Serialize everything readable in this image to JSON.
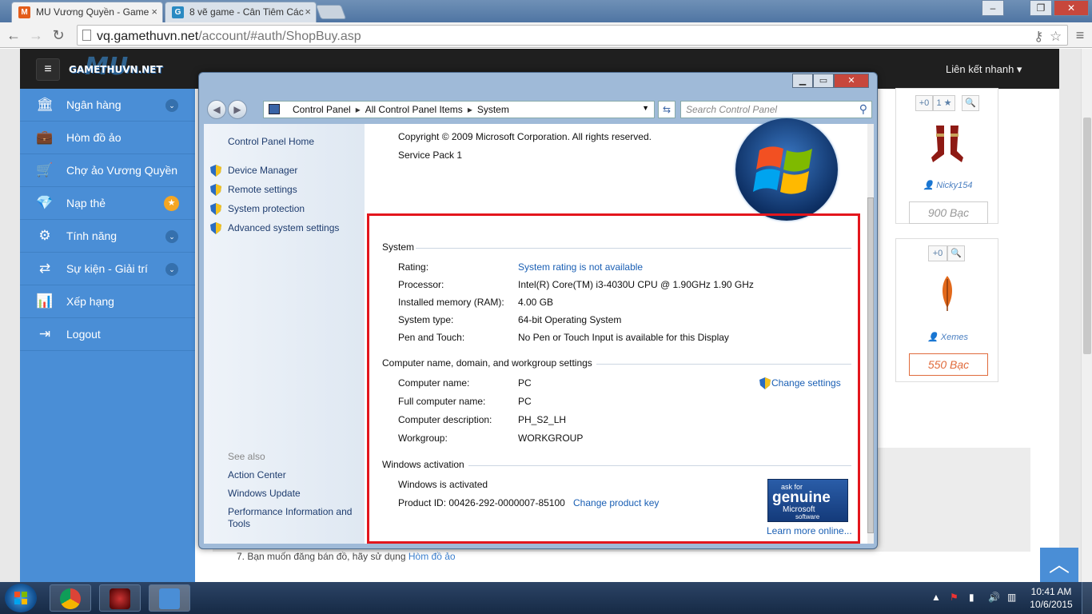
{
  "browser": {
    "tabs": [
      {
        "title": "MU Vương Quyền - Game",
        "close": "×"
      },
      {
        "title": "8 vẽ game - Cân Tiêm Các",
        "close": "×"
      }
    ],
    "url_host": "vq.gamethuvn.net",
    "url_path": "/account/#auth/ShopBuy.asp",
    "window_controls": [
      "–",
      "❐",
      "✕"
    ]
  },
  "site": {
    "logo_text": "GAMETHUVN.NET",
    "logo_mu": "MU",
    "quick_link": "Liên kết nhanh ▾",
    "sidebar": [
      {
        "icon": "bank-icon",
        "glyph": "🏛",
        "label": "Ngân hàng",
        "badge": "⌄"
      },
      {
        "icon": "briefcase-icon",
        "glyph": "💼",
        "label": "Hòm đồ ảo",
        "badge": ""
      },
      {
        "icon": "cart-icon",
        "glyph": "🛒",
        "label": "Chợ ảo Vương Quyền",
        "badge": ""
      },
      {
        "icon": "diamond-icon",
        "glyph": "💎",
        "label": "Nạp thẻ",
        "badge": "★"
      },
      {
        "icon": "gears-icon",
        "glyph": "⚙",
        "label": "Tính năng",
        "badge": "⌄"
      },
      {
        "icon": "share-icon",
        "glyph": "⇄",
        "label": "Sự kiện - Giải trí",
        "badge": "⌄"
      },
      {
        "icon": "chart-icon",
        "glyph": "📊",
        "label": "Xếp hạng",
        "badge": ""
      },
      {
        "icon": "logout-icon",
        "glyph": "⇥",
        "label": "Logout",
        "badge": ""
      }
    ],
    "cards": [
      {
        "btns": [
          "+0",
          "1 ★",
          "🔍"
        ],
        "seller": "Nicky154",
        "price": "900 Bạc"
      },
      {
        "btns": [
          "+0",
          "🔍"
        ],
        "seller": "Xemes",
        "price": "550 Bạc"
      }
    ],
    "note_prefix": "7. Bạn muốn đăng bán đồ, hãy sử dụng ",
    "note_link": "Hòm đồ ảo",
    "scroll_up": "︿"
  },
  "control_panel": {
    "breadcrumb": [
      "Control Panel",
      "All Control Panel Items",
      "System"
    ],
    "search_placeholder": "Search Control Panel",
    "left": {
      "home": "Control Panel Home",
      "links": [
        "Device Manager",
        "Remote settings",
        "System protection",
        "Advanced system settings"
      ],
      "see_also": "See also",
      "see_links": [
        "Action Center",
        "Windows Update",
        "Performance Information and",
        "Tools"
      ]
    },
    "copyright": "Copyright © 2009 Microsoft Corporation.  All rights reserved.",
    "service_pack": "Service Pack 1",
    "system": {
      "header": "System",
      "rows": [
        {
          "label": "Rating:",
          "value": "System rating is not available"
        },
        {
          "label": "Processor:",
          "value": "Intel(R) Core(TM) i3-4030U CPU @ 1.90GHz   1.90 GHz"
        },
        {
          "label": "Installed memory (RAM):",
          "value": "4.00 GB"
        },
        {
          "label": "System type:",
          "value": "64-bit Operating System"
        },
        {
          "label": "Pen and Touch:",
          "value": "No Pen or Touch Input is available for this Display"
        }
      ]
    },
    "computer": {
      "header": "Computer name, domain, and workgroup settings",
      "change_settings": "Change settings",
      "rows": [
        {
          "label": "Computer name:",
          "value": "PC"
        },
        {
          "label": "Full computer name:",
          "value": "PC"
        },
        {
          "label": "Computer description:",
          "value": "PH_S2_LH"
        },
        {
          "label": "Workgroup:",
          "value": "WORKGROUP"
        }
      ]
    },
    "activation": {
      "header": "Windows activation",
      "status": "Windows is activated",
      "product_id": "Product ID:  00426-292-0000007-85100",
      "change_key": "Change product key",
      "learn_more": "Learn more online...",
      "genuine": [
        "ask for",
        "genuine",
        "Microsoft",
        "software"
      ]
    }
  },
  "taskbar": {
    "time": "10:41 AM",
    "date": "10/6/2015"
  }
}
